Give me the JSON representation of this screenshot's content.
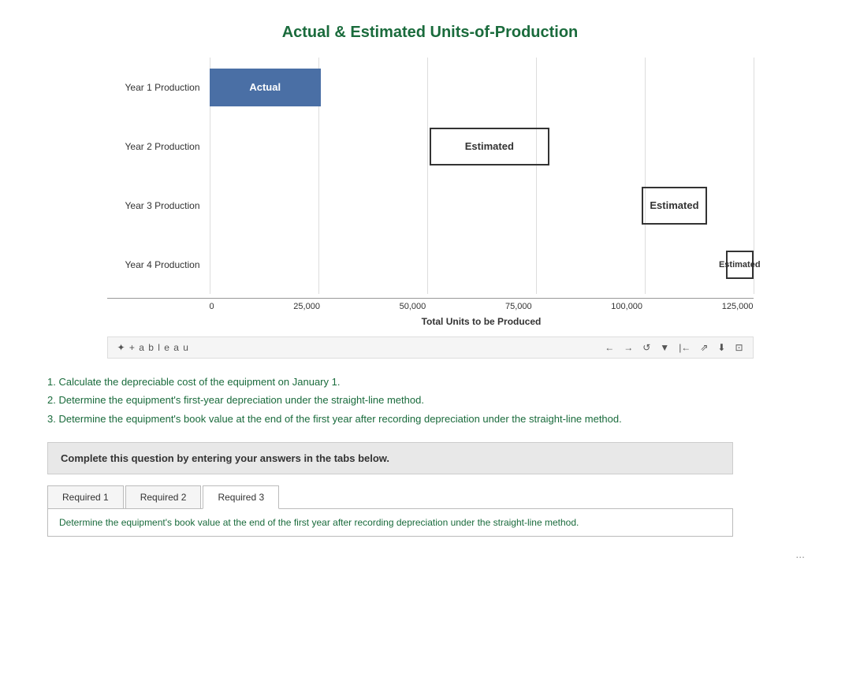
{
  "chart": {
    "title": "Actual & Estimated Units-of-Production",
    "rows": [
      {
        "label": "Year 1 Production",
        "type": "actual",
        "text": "Actual",
        "start_pct": 0,
        "width_pct": 20.5
      },
      {
        "label": "Year 2 Production",
        "type": "estimated",
        "text": "Estimated",
        "start_pct": 40.5,
        "width_pct": 22.0
      },
      {
        "label": "Year 3 Production",
        "type": "estimated",
        "text": "Estimated",
        "start_pct": 79.5,
        "width_pct": 12.0
      },
      {
        "label": "Year 4 Production",
        "type": "estimated",
        "text": "Estimated",
        "start_pct": 95.0,
        "width_pct": 5.5
      }
    ],
    "x_axis_labels": [
      "0",
      "25,000",
      "50,000",
      "75,000",
      "100,000",
      "125,000"
    ],
    "x_axis_title": "Total Units to be Produced"
  },
  "tableau": {
    "logo": "✦ + a b l e a u"
  },
  "instructions": {
    "item1": "1. Calculate the depreciable cost of the equipment on January 1.",
    "item2": "2. Determine the equipment's first-year depreciation under the straight-line method.",
    "item3": "3. Determine the equipment's book value at the end of the first year after recording depreciation under the straight-line method."
  },
  "complete_box": {
    "text": "Complete this question by entering your answers in the tabs below."
  },
  "tabs": {
    "items": [
      {
        "label": "Required 1",
        "active": false
      },
      {
        "label": "Required 2",
        "active": false
      },
      {
        "label": "Required 3",
        "active": true
      }
    ],
    "active_content": "Determine the equipment's book value at the end of the first year after recording depreciation under the straight-line method."
  },
  "bottom": {
    "dots": "..."
  }
}
